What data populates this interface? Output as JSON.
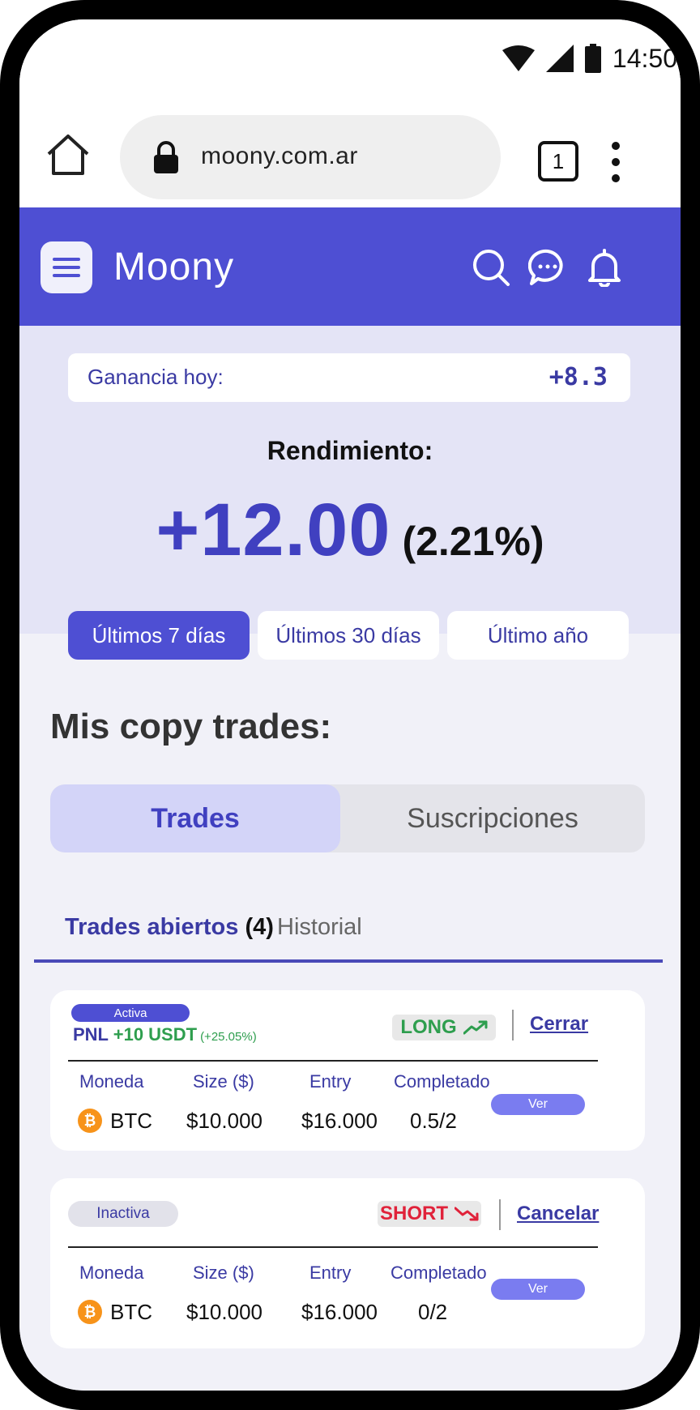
{
  "statusbar": {
    "time": "14:50"
  },
  "browser": {
    "url": "moony.com.ar",
    "tab_count": "1"
  },
  "app": {
    "brand": "Moony"
  },
  "summary": {
    "gain_label": "Ganancia hoy:",
    "gain_value": "+8.3",
    "rendimiento_label": "Rendimiento:",
    "rendimiento_value": "+12.00",
    "rendimiento_pct": "(2.21%)",
    "periods": [
      "Últimos 7 días",
      "Últimos 30 días",
      "Último año"
    ],
    "active_period": "Últimos 7 días"
  },
  "section": {
    "title": "Mis copy trades:"
  },
  "segments": {
    "active": "Trades",
    "inactive": "Suscripciones"
  },
  "subtabs": {
    "open_label": "Trades abiertos",
    "open_count": "(4)",
    "history": "Historial"
  },
  "columns": {
    "coin": "Moneda",
    "size": "Size ($)",
    "entry": "Entry",
    "completed": "Completado"
  },
  "trades": [
    {
      "status": "Activa",
      "pnl_label": "PNL",
      "pnl_value": "+10 USDT",
      "pnl_pct": "(+25.05%)",
      "direction": "LONG",
      "action": "Cerrar",
      "coin": "BTC",
      "size": "$10.000",
      "entry": "$16.000",
      "completed": "0.5/2",
      "view": "Ver"
    },
    {
      "status": "Inactiva",
      "direction": "SHORT",
      "action": "Cancelar",
      "coin": "BTC",
      "size": "$10.000",
      "entry": "$16.000",
      "completed": "0/2",
      "view": "Ver"
    }
  ],
  "colors": {
    "primary": "#4e4fd3",
    "long": "#2e9e4e",
    "short": "#e0223a",
    "coin": "#f7931a"
  },
  "icons": [
    "wifi-icon",
    "signal-icon",
    "battery-icon",
    "home-icon",
    "lock-icon",
    "more-vert-icon",
    "menu-icon",
    "search-icon",
    "chat-icon",
    "bell-icon",
    "trend-up-icon",
    "trend-down-icon",
    "bitcoin-icon"
  ]
}
